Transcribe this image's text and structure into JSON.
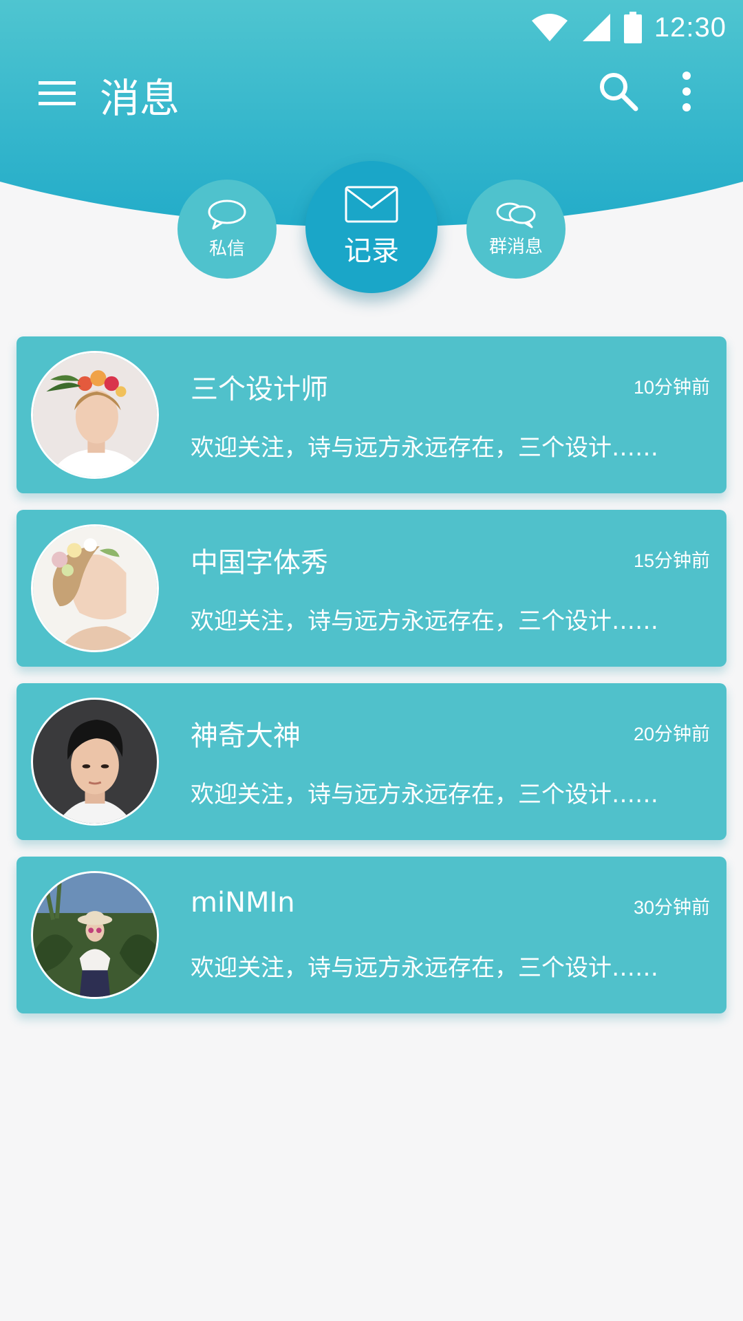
{
  "status_bar": {
    "time": "12:30"
  },
  "app_bar": {
    "title": "消息"
  },
  "tabs": [
    {
      "label": "私信"
    },
    {
      "label": "记录"
    },
    {
      "label": "群消息"
    }
  ],
  "messages": [
    {
      "name": "三个设计师",
      "time": "10分钟前",
      "preview": "欢迎关注，诗与远方永远存在，三个设计……"
    },
    {
      "name": "中国字体秀",
      "time": "15分钟前",
      "preview": "欢迎关注，诗与远方永远存在，三个设计……"
    },
    {
      "name": "神奇大神",
      "time": "20分钟前",
      "preview": "欢迎关注，诗与远方永远存在，三个设计……"
    },
    {
      "name": "miNMIn",
      "time": "30分钟前",
      "preview": "欢迎关注，诗与远方永远存在，三个设计……"
    }
  ],
  "colors": {
    "header_top": "#4fc5d0",
    "header_bottom": "#1ea9c8",
    "card": "#50c1cb",
    "active_tab": "#1aa6c8",
    "background": "#f6f6f7"
  }
}
